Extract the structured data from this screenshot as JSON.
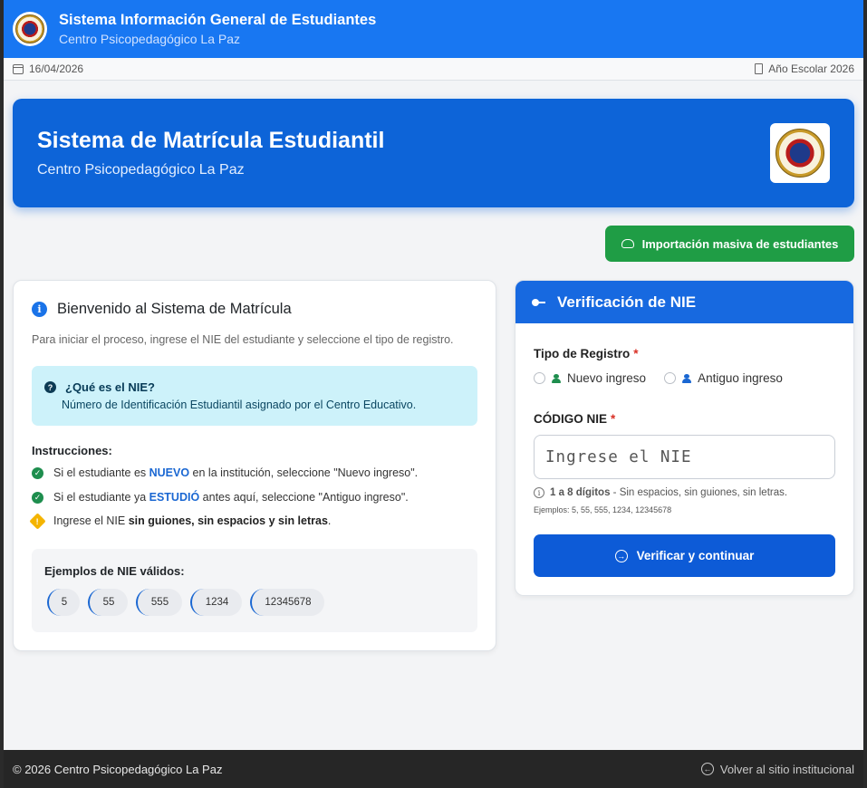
{
  "header": {
    "title": "Sistema Información General de Estudiantes",
    "subtitle": "Centro Psicopedagógico La Paz"
  },
  "info_bar": {
    "date": "16/04/2026",
    "school_year": "Año Escolar 2026"
  },
  "banner": {
    "title": "Sistema de Matrícula Estudiantil",
    "subtitle": "Centro Psicopedagógico La Paz"
  },
  "import_button": {
    "label": "Importación masiva de estudiantes"
  },
  "welcome_card": {
    "title": "Bienvenido al Sistema de Matrícula",
    "intro": "Para iniciar el proceso, ingrese el NIE del estudiante y seleccione el tipo de registro.",
    "nie_question": "¿Qué es el NIE?",
    "nie_definition": "Número de Identificación Estudiantil asignado por el Centro Educativo.",
    "instructions_title": "Instrucciones:",
    "instructions": [
      {
        "pre": "Si el estudiante es ",
        "highlight": "NUEVO",
        "post": " en la institución, seleccione \"Nuevo ingreso\"."
      },
      {
        "pre": "Si el estudiante ya ",
        "highlight": "ESTUDIÓ",
        "post": " antes aquí, seleccione \"Antiguo ingreso\"."
      },
      {
        "pre": "Ingrese el NIE ",
        "highlight": "sin guiones, sin espacios y sin letras",
        "post": "."
      }
    ],
    "examples_title": "Ejemplos de NIE válidos:",
    "examples": [
      "5",
      "55",
      "555",
      "1234",
      "12345678"
    ]
  },
  "verify_card": {
    "title": "Verificación de NIE",
    "type_label": "Tipo de Registro",
    "required_mark": "*",
    "option_new": "Nuevo ingreso",
    "option_old": "Antiguo ingreso",
    "code_label": "CÓDIGO NIE",
    "input_placeholder": "Ingrese el NIE",
    "input_value": "",
    "hint_bold": "1 a 8 dígitos",
    "hint_rest": " - Sin espacios, sin guiones, sin letras.",
    "hint_examples": "Ejemplos: 5, 55, 555, 1234, 12345678",
    "submit_label": "Verificar y continuar"
  },
  "footer": {
    "copyright": "© 2026 Centro Psicopedagógico La Paz",
    "back_link": "Volver al sitio institucional"
  },
  "colors": {
    "header_blue": "#1877f2",
    "banner_blue": "#0d64d8",
    "success_green": "#1f9d45",
    "info_cyan": "#cdf2fa",
    "required_red": "#d93025",
    "footer_dark": "#262626"
  },
  "icons": [
    "calendar-icon",
    "building-icon",
    "cloud-upload-icon",
    "info-icon",
    "question-icon",
    "check-circle-icon",
    "warning-icon",
    "key-icon",
    "user-plus-icon",
    "user-icon",
    "arrow-circle-right-icon",
    "arrow-circle-left-icon"
  ]
}
